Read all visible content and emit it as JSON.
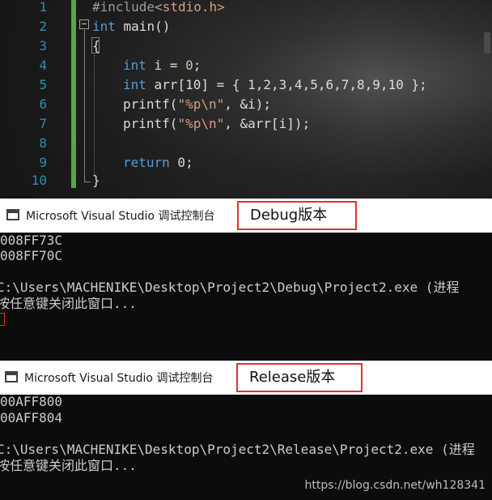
{
  "editor": {
    "line_numbers": [
      "1",
      "2",
      "3",
      "4",
      "5",
      "6",
      "7",
      "8",
      "9",
      "10"
    ],
    "lines": {
      "l1_pp": "#include",
      "l1_inc": "<stdio.h>",
      "l2_kw": "int",
      "l2_rest": " main()",
      "l3": "{",
      "l4_kw": "int",
      "l4_rest": " i = ",
      "l4_num": "0",
      "l4_end": ";",
      "l5_kw": "int",
      "l5_rest": " arr[10] = { 1,2,3,4,5,6,7,8,9,10 };",
      "l6_fn": "printf(",
      "l6_str": "\"%p\\n\"",
      "l6_rest": ", &i);",
      "l7_fn": "printf(",
      "l7_str": "\"%p\\n\"",
      "l7_rest": ", &arr[i]);",
      "l9_kw": "return",
      "l9_num": " 0",
      "l9_end": ";",
      "l10": "}"
    }
  },
  "debug_console": {
    "title": "Microsoft Visual Studio 调试控制台",
    "label": "Debug版本",
    "output": [
      "008FF73C",
      "008FF70C",
      "",
      "C:\\Users\\MACHENIKE\\Desktop\\Project2\\Debug\\Project2.exe (进程",
      "按任意键关闭此窗口..."
    ]
  },
  "release_console": {
    "title": "Microsoft Visual Studio 调试控制台",
    "label": "Release版本",
    "output": [
      "00AFF800",
      "00AFF804",
      "",
      "C:\\Users\\MACHENIKE\\Desktop\\Project2\\Release\\Project2.exe (进程",
      "按任意键关闭此窗口..."
    ]
  },
  "watermark": "https://blog.csdn.net/wh128341",
  "colors": {
    "keyword": "#569cd6",
    "string": "#d69d85",
    "line_number": "#2b91af",
    "highlight_box": "#e0303a",
    "change_bar": "#57a64a"
  }
}
